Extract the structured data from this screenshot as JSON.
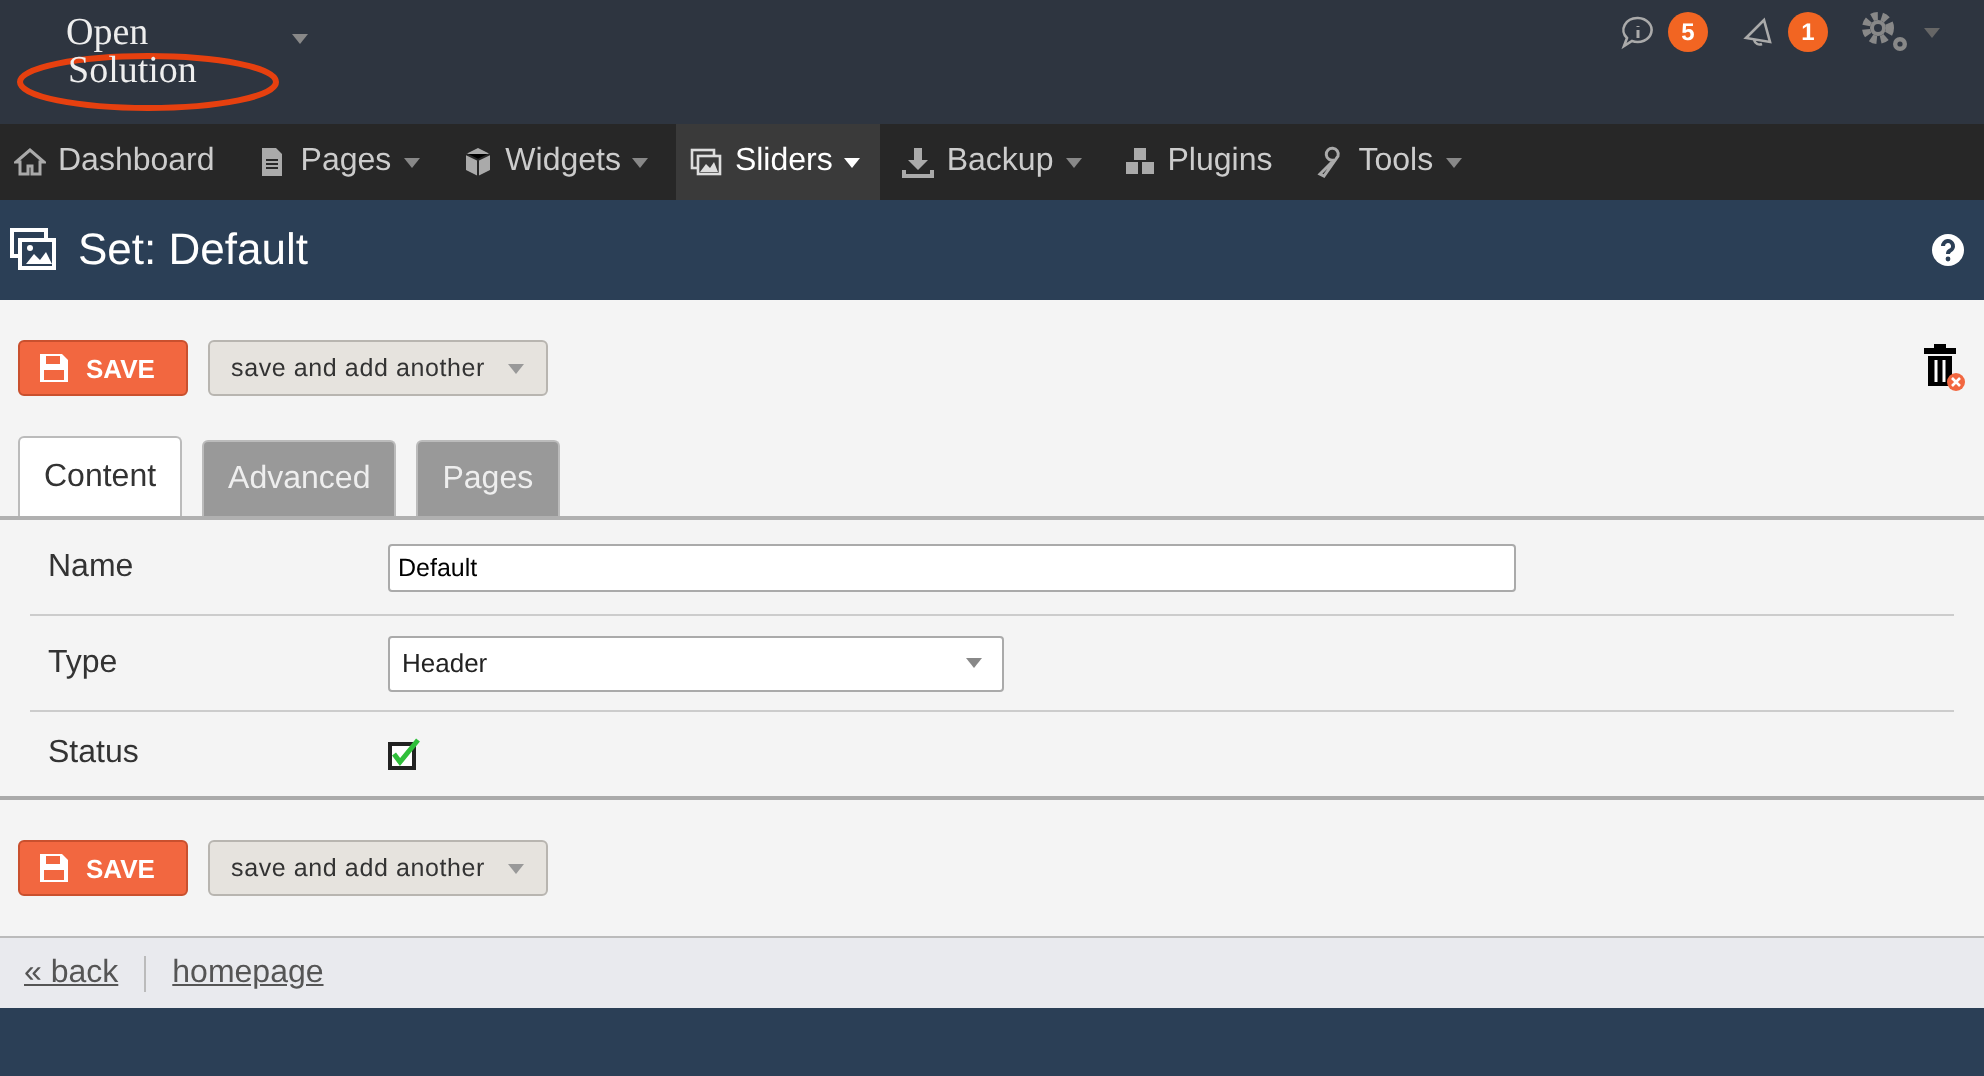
{
  "logo": {
    "line1": "Open",
    "line2": "Solution"
  },
  "notifications": [
    {
      "count": "5"
    },
    {
      "count": "1"
    }
  ],
  "nav": [
    {
      "label": "Dashboard",
      "dropdown": false,
      "selected": false
    },
    {
      "label": "Pages",
      "dropdown": true,
      "selected": false
    },
    {
      "label": "Widgets",
      "dropdown": true,
      "selected": false
    },
    {
      "label": "Sliders",
      "dropdown": true,
      "selected": true
    },
    {
      "label": "Backup",
      "dropdown": true,
      "selected": false
    },
    {
      "label": "Plugins",
      "dropdown": false,
      "selected": false
    },
    {
      "label": "Tools",
      "dropdown": true,
      "selected": false
    }
  ],
  "page_title": "Set: Default",
  "action_bars": [
    {
      "save_label": "SAVE",
      "save_another_label": "save and add another"
    },
    {
      "save_label": "SAVE",
      "save_another_label": "save and add another"
    }
  ],
  "tabs": [
    {
      "label": "Content",
      "selected": true
    },
    {
      "label": "Advanced",
      "selected": false
    },
    {
      "label": "Pages",
      "selected": false
    }
  ],
  "fields": [
    {
      "kind": "text",
      "label": "Name",
      "value": "Default"
    },
    {
      "kind": "select",
      "label": "Type",
      "value": "Header"
    },
    {
      "kind": "checkbox",
      "label": "Status",
      "checked": true
    }
  ],
  "footer_links": [
    "« back",
    "homepage"
  ]
}
